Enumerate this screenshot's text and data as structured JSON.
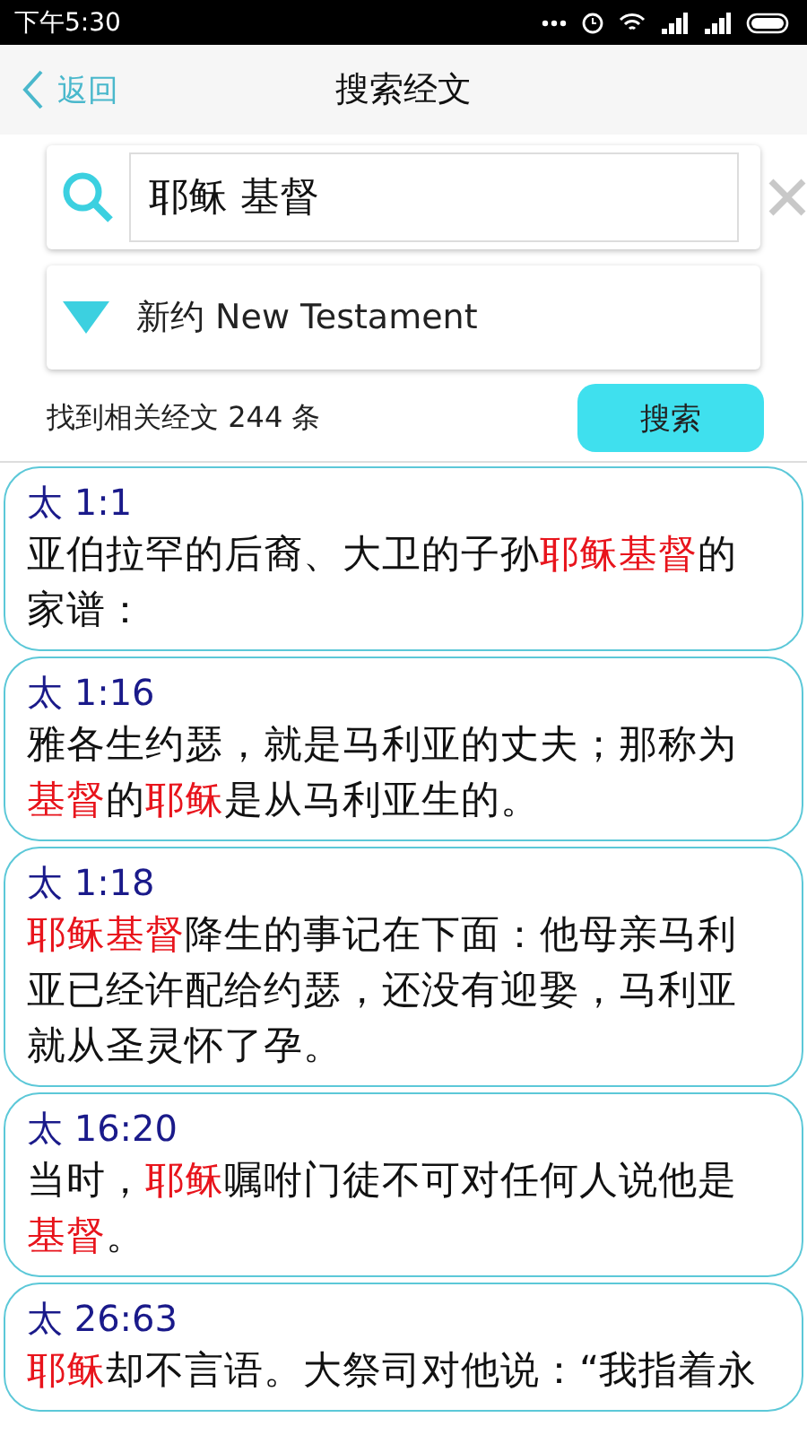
{
  "status_bar": {
    "time": "下午5:30"
  },
  "header": {
    "back": "返回",
    "title": "搜索经文"
  },
  "search": {
    "value": "耶稣 基督"
  },
  "scope": {
    "value": "新约 New Testament"
  },
  "result": {
    "count_text": "找到相关经文 244 条",
    "button": "搜索"
  },
  "verses": [
    {
      "ref": "太 1:1",
      "segments": [
        {
          "text": "亚伯拉罕的后裔、大卫的子孙",
          "hit": false
        },
        {
          "text": "耶稣基督",
          "hit": true
        },
        {
          "text": "的家谱：",
          "hit": false
        }
      ]
    },
    {
      "ref": "太 1:16",
      "segments": [
        {
          "text": "雅各生约瑟，就是马利亚的丈夫；那称为",
          "hit": false
        },
        {
          "text": "基督",
          "hit": true
        },
        {
          "text": "的",
          "hit": false
        },
        {
          "text": "耶稣",
          "hit": true
        },
        {
          "text": "是从马利亚生的。",
          "hit": false
        }
      ]
    },
    {
      "ref": "太 1:18",
      "segments": [
        {
          "text": "耶稣基督",
          "hit": true
        },
        {
          "text": "降生的事记在下面：他母亲马利亚已经许配给约瑟，还没有迎娶，马利亚就从圣灵怀了孕。",
          "hit": false
        }
      ]
    },
    {
      "ref": "太 16:20",
      "segments": [
        {
          "text": "当时，",
          "hit": false
        },
        {
          "text": "耶稣",
          "hit": true
        },
        {
          "text": "嘱咐门徒不可对任何人说他是",
          "hit": false
        },
        {
          "text": "基督",
          "hit": true
        },
        {
          "text": "。",
          "hit": false
        }
      ]
    },
    {
      "ref": "太 26:63",
      "segments": [
        {
          "text": "耶稣",
          "hit": true
        },
        {
          "text": "却不言语。大祭司对他说：“我指着永",
          "hit": false
        }
      ]
    }
  ]
}
